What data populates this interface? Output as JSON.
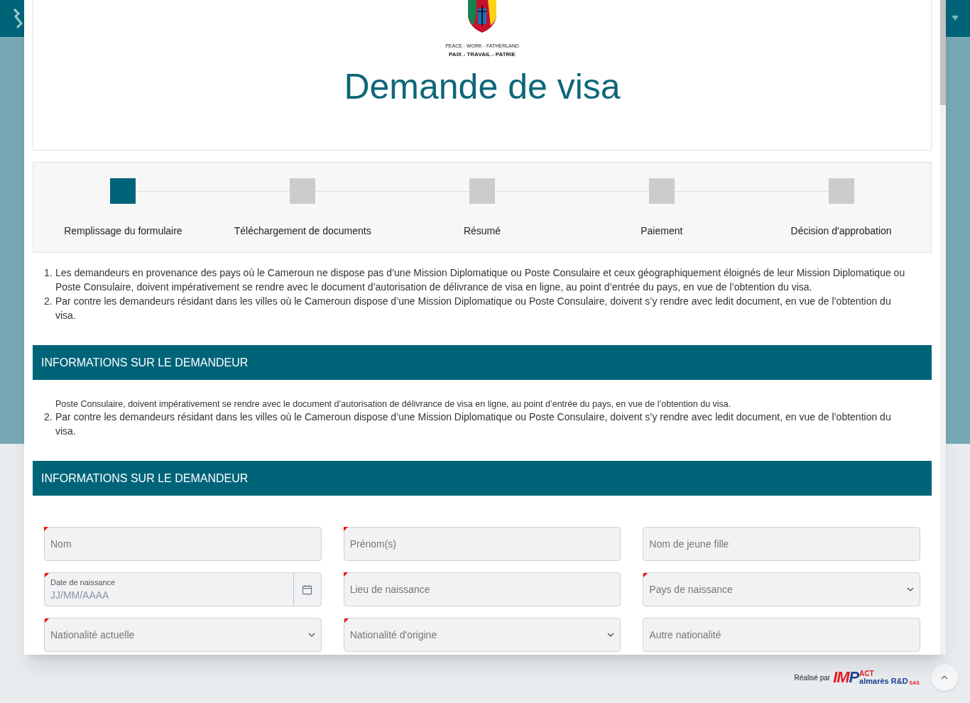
{
  "logo": {
    "motto_en": "PEACE - WORK - FATHERLAND",
    "motto_fr": "PAIX - TRAVAIL - PATRIE"
  },
  "title": "Demande de visa",
  "steps": [
    {
      "label": "Remplissage du formulaire",
      "selected": true
    },
    {
      "label": "Téléchargement de documents",
      "selected": false
    },
    {
      "label": "Résumé",
      "selected": false
    },
    {
      "label": "Paiement",
      "selected": false
    },
    {
      "label": "Décision d'approbation",
      "selected": false
    }
  ],
  "notes": [
    {
      "number": "1.",
      "text": "Les demandeurs en provenance des pays où le Cameroun ne dispose pas d’une Mission Diplomatique ou Poste Consulaire et ceux géographiquement éloignés de leur Mission Diplomatique ou Poste Consulaire, doivent impérativement se rendre avec le document d’autorisation de délivrance de visa en ligne, au point d’entrée du pays, en vue de l’obtention du visa."
    },
    {
      "number": "2.",
      "text": "Par contre les demandeurs résidant dans les villes où le Cameroun dispose d’une Mission Diplomatique ou Poste Consulaire, doivent s’y rendre avec ledit document, en vue de l’obtention du visa."
    }
  ],
  "section_title": "INFORMATIONS SUR LE DEMANDEUR",
  "repeat": {
    "clipped_line": "Poste Consulaire, doivent impérativement se rendre avec le document d’autorisation de délivrance de visa en ligne, au point d’entrée du pays, en vue de l’obtention du visa.",
    "notes": [
      {
        "number": "2.",
        "text": "Par contre les demandeurs résidant dans les villes où le Cameroun dispose d’une Mission Diplomatique ou Poste Consulaire, doivent s’y rendre avec ledit document, en vue de l’obtention du visa."
      }
    ],
    "section_title": "INFORMATIONS SUR LE DEMANDEUR"
  },
  "fields": [
    {
      "kind": "text",
      "placeholder": "Nom",
      "required": true
    },
    {
      "kind": "text",
      "placeholder": "Prénom(s)",
      "required": true
    },
    {
      "kind": "text",
      "placeholder": "Nom de jeune fille",
      "required": false
    },
    {
      "kind": "date",
      "label": "Date de naissance",
      "placeholder": "JJ/MM/AAAA",
      "required": true
    },
    {
      "kind": "text",
      "placeholder": "Lieu de naissance",
      "required": true
    },
    {
      "kind": "select",
      "placeholder": "Pays de naissance",
      "required": true
    },
    {
      "kind": "select",
      "placeholder": "Nationalité actuelle",
      "required": true
    },
    {
      "kind": "select",
      "placeholder": "Nationalité d'origine",
      "required": true
    },
    {
      "kind": "text",
      "placeholder": "Autre nationalité",
      "required": false
    }
  ],
  "footer": {
    "credit": "Réalisé par",
    "brand_top": "ACT",
    "brand_main": "IM",
    "brand_p": "P",
    "brand_name": "almarès R&D",
    "brand_suffix": "SAS"
  }
}
